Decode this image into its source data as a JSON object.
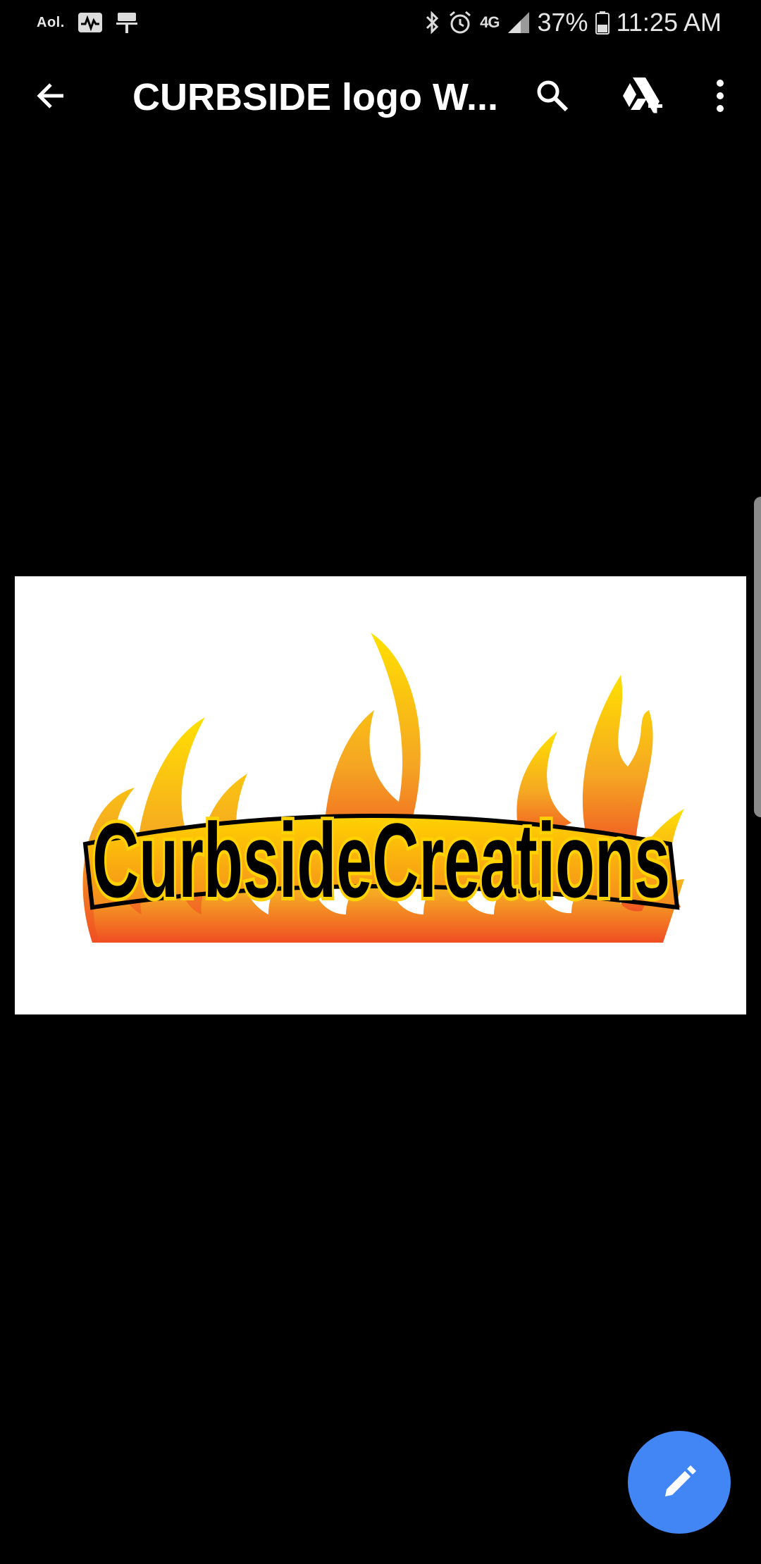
{
  "status_bar": {
    "left_apps": [
      "aol-icon",
      "activity-icon",
      "keyboard-icon"
    ],
    "aol_label": "Aol.",
    "network_label": "4G",
    "battery": "37%",
    "time": "11:25 AM"
  },
  "app_bar": {
    "title": "CURBSIDE logo W..."
  },
  "image": {
    "logo_text": "CurbsideCreations",
    "colors": {
      "flame_yellow": "#ffe000",
      "flame_orange": "#f5a623",
      "flame_red": "#f04e23",
      "text_fill": "#000000",
      "text_outline": "#ffd200"
    }
  },
  "fab": {
    "icon": "edit-icon",
    "color": "#4285f4"
  }
}
